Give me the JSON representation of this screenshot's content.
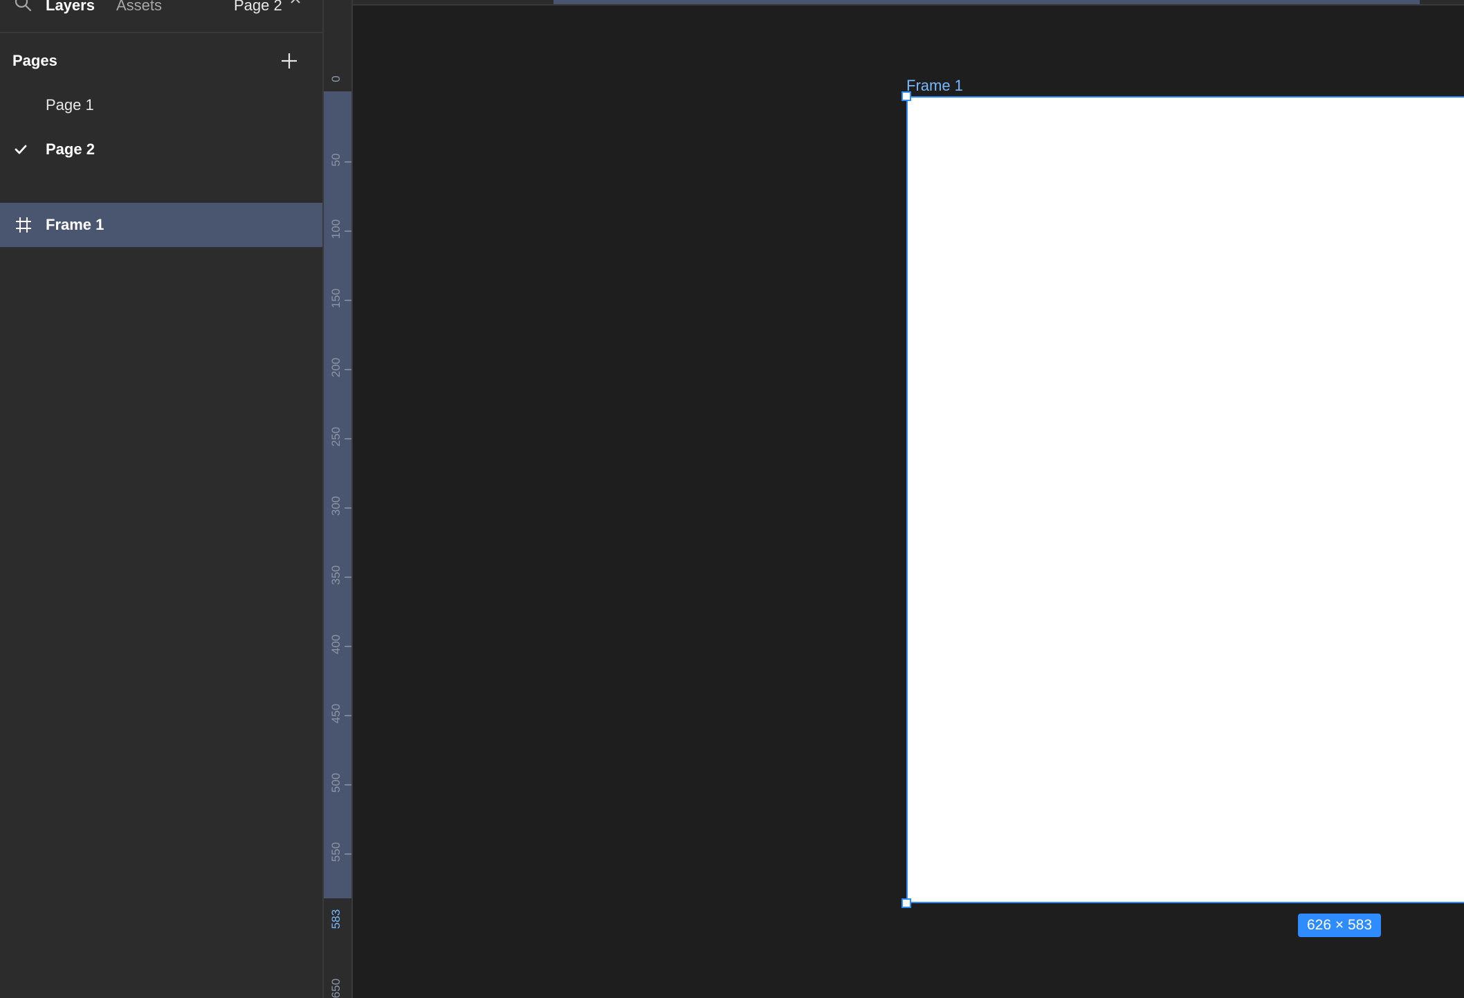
{
  "header": {
    "tab_layers": "Layers",
    "tab_assets": "Assets",
    "current_page": "Page 2",
    "search_icon": "search-icon",
    "chevron_icon": "chevron-up-icon"
  },
  "pages": {
    "title": "Pages",
    "add_icon": "plus-icon",
    "items": [
      {
        "label": "Page 1",
        "selected": false
      },
      {
        "label": "Page 2",
        "selected": true
      }
    ]
  },
  "layers": [
    {
      "label": "Frame 1",
      "icon": "frame-icon",
      "selected": true
    }
  ],
  "ruler": {
    "vertical_ticks": [
      "0",
      "50",
      "100",
      "150",
      "200",
      "250",
      "300",
      "350",
      "400",
      "450",
      "500",
      "550",
      "583",
      "650"
    ],
    "active_tick": "583"
  },
  "canvas": {
    "frame_label": "Frame 1",
    "size_badge": "626 × 583",
    "accent_color": "#2f8cff",
    "selection_color": "#4a5670"
  }
}
